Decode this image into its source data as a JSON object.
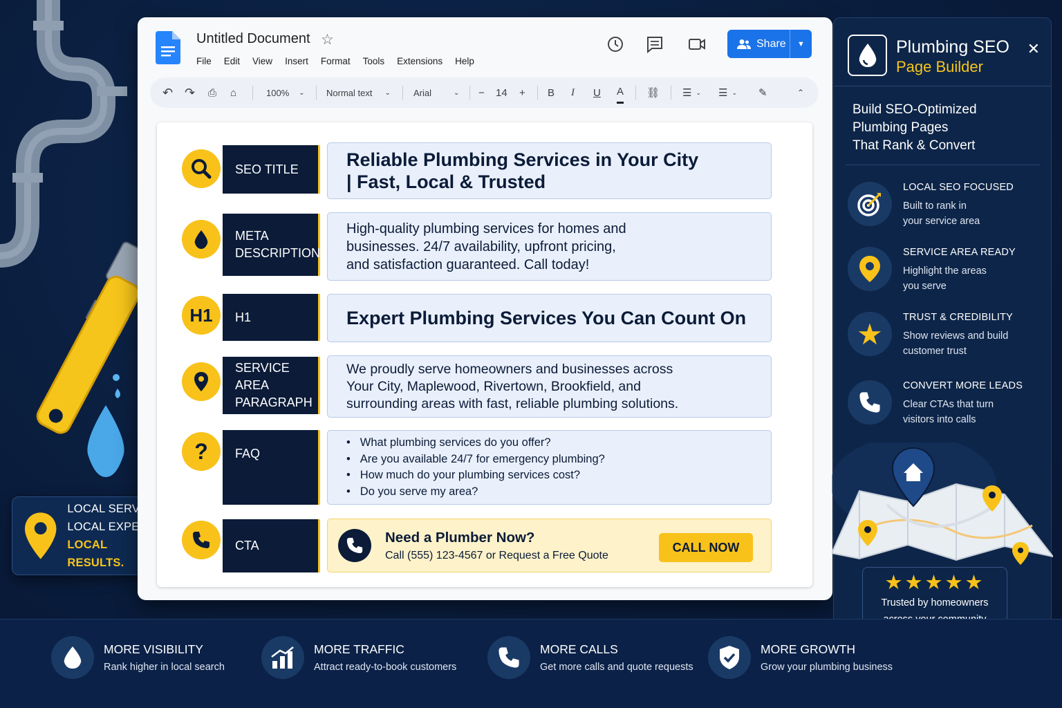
{
  "doc": {
    "title": "Untitled Document",
    "menu": [
      "File",
      "Edit",
      "View",
      "Insert",
      "Format",
      "Tools",
      "Extensions",
      "Help"
    ],
    "share_label": "Share",
    "toolbar": {
      "zoom": "100%",
      "style": "Normal text",
      "font": "Arial",
      "font_size": "14",
      "minus": "−",
      "plus": "+",
      "bold": "B",
      "italic": "I",
      "underline": "U",
      "text_color": "A"
    }
  },
  "rows": [
    {
      "label": "SEO TITLE",
      "icon": "search-icon",
      "content": [
        "Reliable Plumbing Services in Your City",
        "| Fast, Local & Trusted"
      ]
    },
    {
      "label": "META DESCRIPTION",
      "icon": "water-drop-icon",
      "content": [
        "High-quality plumbing services for homes and",
        "businesses. 24/7 availability, upfront pricing,",
        "and satisfaction guaranteed. Call today!"
      ]
    },
    {
      "label": "H1",
      "icon_text": "H1",
      "content": "Expert Plumbing Services You Can Count On"
    },
    {
      "label": "SERVICE AREA PARAGRAPH",
      "icon": "map-pin-icon",
      "content": [
        "We proudly serve homeowners and businesses across",
        "Your City, Maplewood, Rivertown, Brookfield, and",
        "surrounding areas with fast, reliable plumbing solutions."
      ]
    },
    {
      "label": "FAQ",
      "icon_text": "?",
      "faq": [
        "What plumbing services do you offer?",
        "Are you available 24/7 for emergency plumbing?",
        "How much do your plumbing services cost?",
        "Do you serve my area?"
      ]
    },
    {
      "label": "CTA",
      "icon": "phone-icon",
      "cta_head": "Need a Plumber Now?",
      "cta_sub": "Call (555) 123-4567 or Request a Free Quote",
      "cta_button": "CALL NOW"
    }
  ],
  "panel": {
    "title": "Plumbing SEO",
    "subtitle": "Page Builder",
    "intro": [
      "Build SEO-Optimized",
      "Plumbing Pages",
      "That Rank & Convert"
    ],
    "features": [
      {
        "icon": "target-icon",
        "title": "LOCAL SEO FOCUSED",
        "desc": [
          "Built to rank in",
          "your service area"
        ]
      },
      {
        "icon": "map-pin-icon",
        "title": "SERVICE AREA READY",
        "desc": [
          "Highlight the areas",
          "you serve"
        ]
      },
      {
        "icon": "star-icon",
        "title": "TRUST & CREDIBILITY",
        "desc": [
          "Show reviews and build",
          "customer trust"
        ]
      },
      {
        "icon": "phone-icon",
        "title": "CONVERT MORE LEADS",
        "desc": [
          "Clear CTAs that turn",
          "visitors into calls"
        ]
      }
    ],
    "trust": {
      "stars": "★★★★★",
      "rating": 5,
      "text": [
        "Trusted by homeowners",
        "across your community"
      ]
    }
  },
  "badge": {
    "lines": [
      "LOCAL SERVICE.",
      "LOCAL EXPERTS.",
      "LOCAL RESULTS."
    ]
  },
  "benefits": [
    {
      "icon": "water-drop-icon",
      "title": "MORE VISIBILITY",
      "desc": "Rank higher in local search"
    },
    {
      "icon": "chart-icon",
      "title": "MORE TRAFFIC",
      "desc": "Attract ready-to-book customers"
    },
    {
      "icon": "phone-icon",
      "title": "MORE CALLS",
      "desc": "Get more calls and quote requests"
    },
    {
      "icon": "shield-check-icon",
      "title": "MORE GROWTH",
      "desc": "Grow your plumbing business"
    }
  ],
  "colors": {
    "accent": "#f8c21a",
    "navy": "#0b1b38",
    "share_blue": "#1a73e8",
    "content_bg": "#e9f0fb"
  }
}
